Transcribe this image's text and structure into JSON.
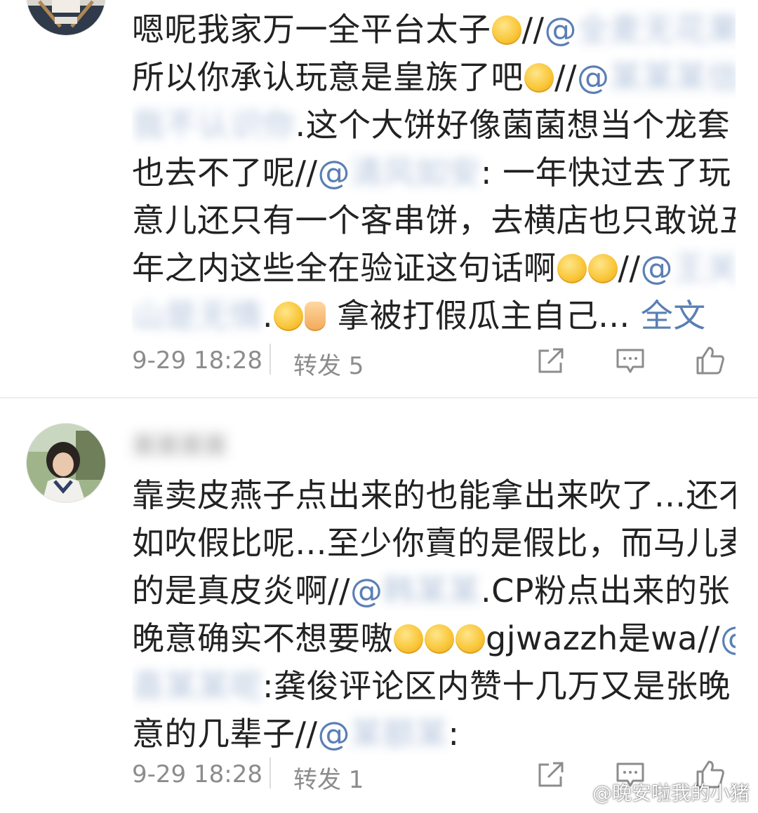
{
  "post1": {
    "lines": [
      [
        {
          "t": "text",
          "v": "嗯呢我家万一全平台太子"
        },
        {
          "t": "emoji",
          "name": "pleading-emoji"
        },
        {
          "t": "text",
          "v": "//"
        },
        {
          "t": "mention",
          "v": "@"
        },
        {
          "t": "redact",
          "v": "全麦无花果"
        },
        {
          "t": "text",
          "v": "."
        }
      ],
      [
        {
          "t": "text",
          "v": "所以你承认玩意是皇族了吧"
        },
        {
          "t": "emoji",
          "name": "shush-emoji"
        },
        {
          "t": "text",
          "v": "//"
        },
        {
          "t": "mention",
          "v": "@"
        },
        {
          "t": "redact",
          "v": "某某某信啊"
        }
      ],
      [
        {
          "t": "redact",
          "v": "我不认识你"
        },
        {
          "t": "text",
          "v": ".这个大饼好像菌菌想当个龙套"
        }
      ],
      [
        {
          "t": "text",
          "v": "也去不了呢//"
        },
        {
          "t": "mention",
          "v": "@"
        },
        {
          "t": "redact",
          "v": "清风如安"
        },
        {
          "t": "text",
          "v": ": 一年快过去了玩"
        }
      ],
      [
        {
          "t": "text",
          "v": "意儿还只有一个客串饼，去横店也只敢说五"
        }
      ],
      [
        {
          "t": "text",
          "v": "年之内这些全在验证这句话啊"
        },
        {
          "t": "emoji",
          "name": "yawn-emoji"
        },
        {
          "t": "emoji",
          "name": "yawn-emoji"
        },
        {
          "t": "text",
          "v": "//"
        },
        {
          "t": "mention",
          "v": "@"
        },
        {
          "t": "redact",
          "v": "王关"
        }
      ],
      [
        {
          "t": "redact",
          "v": "山是无情"
        },
        {
          "t": "text",
          "v": "."
        },
        {
          "t": "emoji",
          "name": "laugh-cry-emoji"
        },
        {
          "t": "emoji",
          "name": "thumbs-up-emoji",
          "thumb": true
        },
        {
          "t": "text",
          "v": " 拿被打假瓜主自己... "
        },
        {
          "t": "fulltext",
          "v": "全文"
        }
      ]
    ],
    "time": "9-29 18:28",
    "repost": "转发 5"
  },
  "post2": {
    "username": "某某某某",
    "lines": [
      [
        {
          "t": "text",
          "v": "靠卖皮燕子点出来的也能拿出来吹了...还不"
        }
      ],
      [
        {
          "t": "text",
          "v": "如吹假比呢...至少你賣的是假比，而马儿麦"
        }
      ],
      [
        {
          "t": "text",
          "v": "的是真皮炎啊//"
        },
        {
          "t": "mention",
          "v": "@"
        },
        {
          "t": "redact",
          "v": "韩某某"
        },
        {
          "t": "text",
          "v": ".CP粉点出来的张"
        }
      ],
      [
        {
          "t": "text",
          "v": "晚意确实不想要嗷"
        },
        {
          "t": "emoji",
          "name": "cry-emoji"
        },
        {
          "t": "emoji",
          "name": "cry-emoji"
        },
        {
          "t": "emoji",
          "name": "cry-emoji"
        },
        {
          "t": "text",
          "v": "gjwazzh是wa//"
        },
        {
          "t": "mention",
          "v": "@"
        }
      ],
      [
        {
          "t": "redact",
          "v": "喜某某呢"
        },
        {
          "t": "text",
          "v": ":龚俊评论区内赞十几万又是张晚"
        }
      ],
      [
        {
          "t": "text",
          "v": "意的几辈子//"
        },
        {
          "t": "mention",
          "v": "@"
        },
        {
          "t": "redact",
          "v": "某额某"
        },
        {
          "t": "text",
          "v": ":"
        }
      ]
    ],
    "time": "9-29 18:28",
    "repost": "转发 1"
  },
  "watermark": "@晚安啦我的小猪",
  "colors": {
    "link": "#5b7fb4",
    "text": "#222222",
    "meta": "#8c8c8c"
  }
}
